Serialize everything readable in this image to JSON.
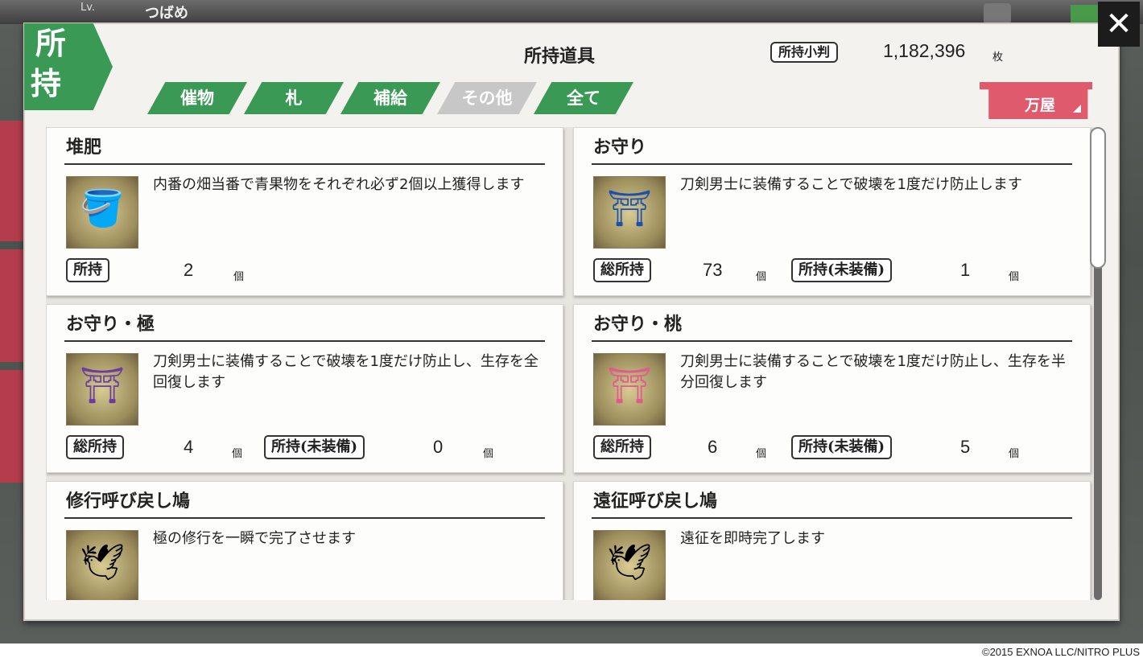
{
  "background": {
    "level_label": "Lv.",
    "player_name": "つばめ"
  },
  "modal": {
    "corner_tag": [
      "所",
      "持"
    ],
    "title": "所持道具",
    "coin_label": "所持小判",
    "coin_value": "1,182,396",
    "coin_unit": "枚",
    "tabs": [
      {
        "label": "催物",
        "active": false
      },
      {
        "label": "札",
        "active": false
      },
      {
        "label": "補給",
        "active": false
      },
      {
        "label": "その他",
        "active": true
      },
      {
        "label": "全て",
        "active": false
      }
    ],
    "shop_label": "万屋",
    "close_label": "✕"
  },
  "items": [
    {
      "name": "堆肥",
      "description": "内番の畑当番で青果物をそれぞれ必ず2個以上獲得します",
      "badge1": "所持",
      "count1": "2",
      "unit1": "個",
      "badge2": "",
      "count2": "",
      "unit2": ""
    },
    {
      "name": "お守り",
      "description": "刀剣男士に装備することで破壊を1度だけ防止します",
      "badge1": "総所持",
      "count1": "73",
      "unit1": "個",
      "badge2": "所持(未装備)",
      "count2": "1",
      "unit2": "個"
    },
    {
      "name": "お守り・極",
      "description": "刀剣男士に装備することで破壊を1度だけ防止し、生存を全回復します",
      "badge1": "総所持",
      "count1": "4",
      "unit1": "個",
      "badge2": "所持(未装備)",
      "count2": "0",
      "unit2": "個"
    },
    {
      "name": "お守り・桃",
      "description": "刀剣男士に装備することで破壊を1度だけ防止し、生存を半分回復します",
      "badge1": "総所持",
      "count1": "6",
      "unit1": "個",
      "badge2": "所持(未装備)",
      "count2": "5",
      "unit2": "個"
    },
    {
      "name": "修行呼び戻し鳩",
      "description": "極の修行を一瞬で完了させます"
    },
    {
      "name": "遠征呼び戻し鳩",
      "description": "遠征を即時完了します"
    }
  ],
  "footer": {
    "copyright": "©2015 EXNOA LLC/NITRO PLUS"
  },
  "colors": {
    "tab_green": "#3a9a55",
    "tab_inactive_gray": "#c7c7c7",
    "shop_pink": "#e05a6e"
  }
}
